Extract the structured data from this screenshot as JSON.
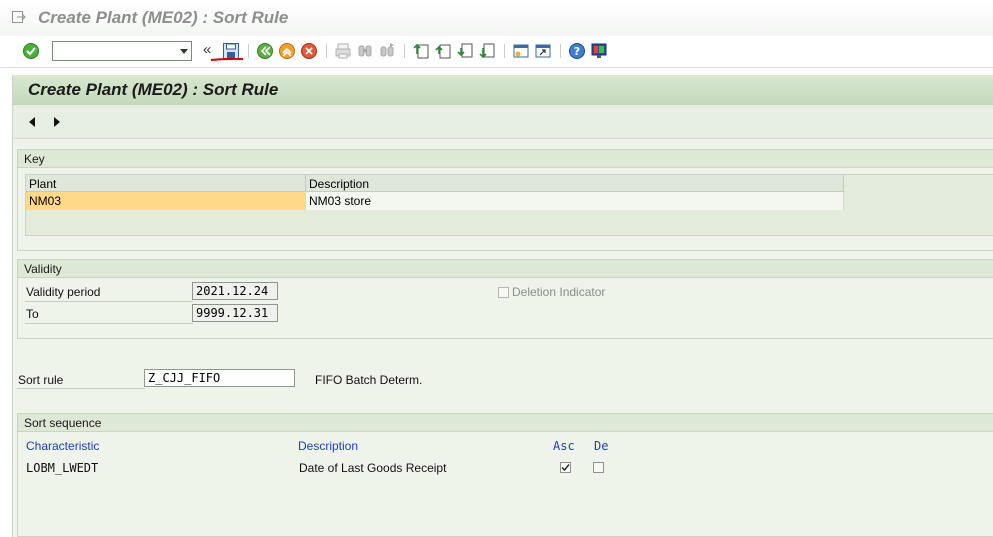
{
  "title_bar": {
    "title": "Create Plant (ME02) : Sort Rule"
  },
  "toolbar": {
    "command_field_value": "",
    "collapse_glyph": "«"
  },
  "header": {
    "title": "Create Plant (ME02) : Sort Rule"
  },
  "key": {
    "title": "Key",
    "columns": [
      "Plant",
      "Description"
    ],
    "rows": [
      {
        "plant": "NM03",
        "description": "NM03 store"
      }
    ]
  },
  "validity": {
    "title": "Validity",
    "period_label": "Validity period",
    "period_value": "2021.12.24",
    "to_label": "To",
    "to_value": "9999.12.31",
    "deletion_label": "Deletion Indicator",
    "deletion_checked": false
  },
  "sort_rule": {
    "label": "Sort rule",
    "value": "Z_CJJ_FIFO",
    "description": "FIFO Batch Determ."
  },
  "sort_sequence": {
    "title": "Sort sequence",
    "columns": {
      "characteristic": "Characteristic",
      "description": "Description",
      "asc": "Asc",
      "desc": "De"
    },
    "rows": [
      {
        "characteristic": "LOBM_LWEDT",
        "description": "Date of Last Goods Receipt",
        "asc": true,
        "desc": false
      }
    ]
  },
  "colors": {
    "header_green": "#c3d8b9",
    "panel_bg": "#eef4ea",
    "selected_cell": "#ffd98a",
    "link_blue": "#1b40c6",
    "annotation_red": "#d40000"
  },
  "icons": [
    "page-icon",
    "enter-icon",
    "save-icon",
    "back-icon",
    "exit-icon",
    "cancel-icon",
    "print-icon",
    "find-icon",
    "find-next-icon",
    "first-page-icon",
    "previous-page-icon",
    "next-page-icon",
    "last-page-icon",
    "create-session-icon",
    "shortcut-icon",
    "help-icon",
    "layout-menu-icon",
    "nav-prev-icon",
    "nav-next-icon"
  ]
}
